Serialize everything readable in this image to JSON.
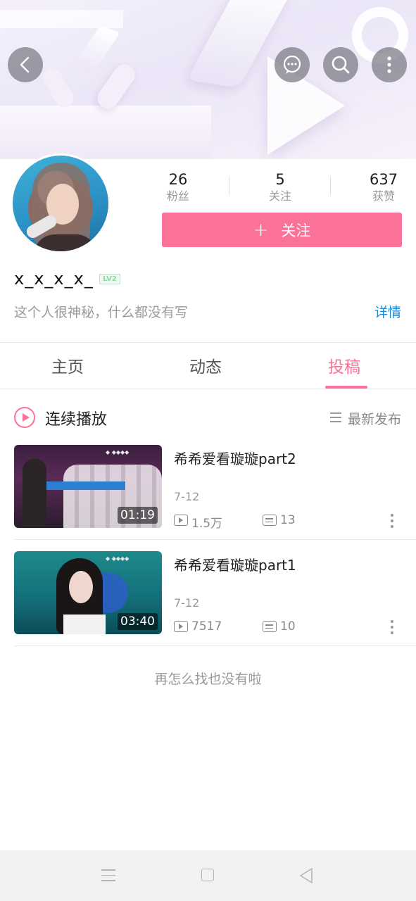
{
  "header": {
    "back_icon": "chevron-left-icon",
    "message_icon": "chat-bubble-icon",
    "search_icon": "search-icon",
    "more_icon": "vertical-dots-icon"
  },
  "profile": {
    "stats": [
      {
        "value": "26",
        "label": "粉丝"
      },
      {
        "value": "5",
        "label": "关注"
      },
      {
        "value": "637",
        "label": "获赞"
      }
    ],
    "follow_plus": "+",
    "follow_label": "关注",
    "username": "x_x_x_x_",
    "level": "LV2",
    "bio": "这个人很神秘，什么都没有写",
    "detail_link": "详情"
  },
  "tabs": [
    {
      "label": "主页",
      "active": false
    },
    {
      "label": "动态",
      "active": false
    },
    {
      "label": "投稿",
      "active": true
    }
  ],
  "playlist": {
    "continuous_label": "连续播放",
    "sort_label": "最新发布"
  },
  "videos": [
    {
      "title": "希希爱看璇璇part2",
      "date": "7-12",
      "duration": "01:19",
      "views": "1.5万",
      "comments": "13"
    },
    {
      "title": "希希爱看璇璇part1",
      "date": "7-12",
      "duration": "03:40",
      "views": "7517",
      "comments": "10"
    }
  ],
  "end_message": "再怎么找也没有啦",
  "colors": {
    "accent": "#fb7299",
    "link": "#1c8ad0",
    "level_badge": "#8ed8a5"
  }
}
